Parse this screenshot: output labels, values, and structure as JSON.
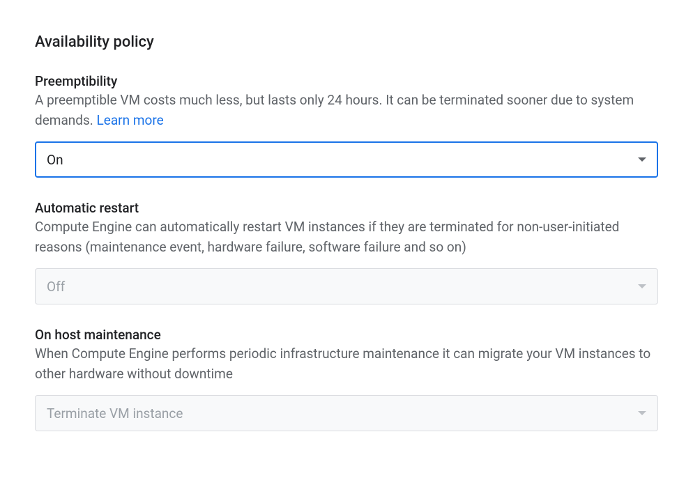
{
  "section": {
    "title": "Availability policy"
  },
  "preemptibility": {
    "label": "Preemptibility",
    "description": "A preemptible VM costs much less, but lasts only 24 hours. It can be terminated sooner due to system demands. ",
    "learn_more": "Learn more",
    "value": "On"
  },
  "automatic_restart": {
    "label": "Automatic restart",
    "description": "Compute Engine can automatically restart VM instances if they are terminated for non-user-initiated reasons (maintenance event, hardware failure, software failure and so on)",
    "value": "Off"
  },
  "host_maintenance": {
    "label": "On host maintenance",
    "description": "When Compute Engine performs periodic infrastructure maintenance it can migrate your VM instances to other hardware without downtime",
    "value": "Terminate VM instance"
  }
}
